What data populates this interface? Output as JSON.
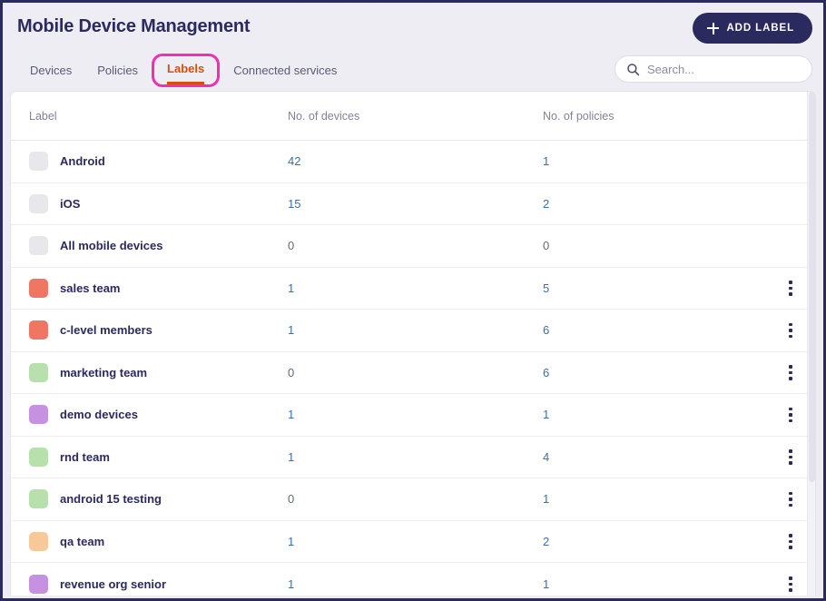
{
  "header": {
    "title": "Mobile Device Management",
    "add_label_button": "ADD LABEL",
    "add_icon": "plus-icon"
  },
  "tabs": [
    {
      "label": "Devices",
      "active": false,
      "focused": false
    },
    {
      "label": "Policies",
      "active": false,
      "focused": false
    },
    {
      "label": "Labels",
      "active": true,
      "focused": true
    },
    {
      "label": "Connected services",
      "active": false,
      "focused": false
    }
  ],
  "search": {
    "placeholder": "Search...",
    "value": "",
    "icon": "search-icon"
  },
  "table": {
    "columns": [
      "Label",
      "No. of devices",
      "No. of policies"
    ],
    "rows": [
      {
        "label": "Android",
        "swatch": "#e8e8ec",
        "devices": "42",
        "policies": "1",
        "menu": false
      },
      {
        "label": "iOS",
        "swatch": "#e8e8ec",
        "devices": "15",
        "policies": "2",
        "menu": false
      },
      {
        "label": "All mobile devices",
        "swatch": "#e8e8ec",
        "devices": "0",
        "policies": "0",
        "menu": false
      },
      {
        "label": "sales team",
        "swatch": "#ee7663",
        "devices": "1",
        "policies": "5",
        "menu": true
      },
      {
        "label": "c-level members",
        "swatch": "#ee7663",
        "devices": "1",
        "policies": "6",
        "menu": true
      },
      {
        "label": "marketing team",
        "swatch": "#b7e0ad",
        "devices": "0",
        "policies": "6",
        "menu": true
      },
      {
        "label": "demo devices",
        "swatch": "#c691e0",
        "devices": "1",
        "policies": "1",
        "menu": true
      },
      {
        "label": "rnd team",
        "swatch": "#b7e0ad",
        "devices": "1",
        "policies": "4",
        "menu": true
      },
      {
        "label": "android 15 testing",
        "swatch": "#b7e0ad",
        "devices": "0",
        "policies": "1",
        "menu": true
      },
      {
        "label": "qa team",
        "swatch": "#f7c99a",
        "devices": "1",
        "policies": "2",
        "menu": true
      },
      {
        "label": "revenue org senior",
        "swatch": "#c691e0",
        "devices": "1",
        "policies": "1",
        "menu": true
      }
    ]
  },
  "colors": {
    "page_background": "#eeedf4",
    "window_border": "#2b2a5e",
    "primary_navy": "#2b2a5e",
    "active_tab": "#d2500c",
    "focus_ring": "#f02fb2",
    "link_blue": "#3b6fa8"
  }
}
